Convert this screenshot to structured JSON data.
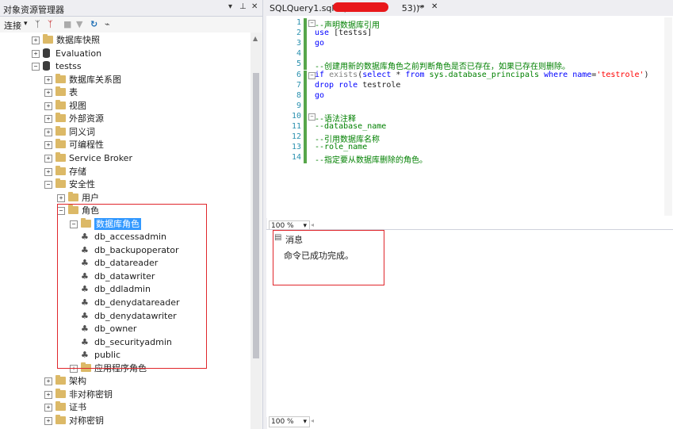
{
  "object_explorer": {
    "title": "对象资源管理器",
    "toolbar": {
      "connect_label": "连接",
      "dropdown_glyph": "▾"
    },
    "tree": [
      {
        "label": "数据库快照",
        "icon": "folder-icon",
        "expander": "+"
      },
      {
        "label": "Evaluation",
        "icon": "database-icon",
        "expander": "+"
      },
      {
        "label": "testss",
        "icon": "database-icon",
        "expander": "−"
      },
      {
        "label": "数据库关系图",
        "icon": "folder-icon",
        "expander": "+"
      },
      {
        "label": "表",
        "icon": "folder-icon",
        "expander": "+"
      },
      {
        "label": "视图",
        "icon": "folder-icon",
        "expander": "+"
      },
      {
        "label": "外部资源",
        "icon": "folder-icon",
        "expander": "+"
      },
      {
        "label": "同义词",
        "icon": "folder-icon",
        "expander": "+"
      },
      {
        "label": "可编程性",
        "icon": "folder-icon",
        "expander": "+"
      },
      {
        "label": "Service Broker",
        "icon": "folder-icon",
        "expander": "+"
      },
      {
        "label": "存储",
        "icon": "folder-icon",
        "expander": "+"
      },
      {
        "label": "安全性",
        "icon": "folder-icon",
        "expander": "−"
      },
      {
        "label": "用户",
        "icon": "folder-icon",
        "expander": "+"
      },
      {
        "label": "角色",
        "icon": "folder-icon",
        "expander": "−"
      },
      {
        "label": "数据库角色",
        "icon": "folder-icon",
        "expander": "−",
        "selected": true
      },
      {
        "label": "db_accessadmin",
        "icon": "role-icon",
        "expander": ""
      },
      {
        "label": "db_backupoperator",
        "icon": "role-icon",
        "expander": ""
      },
      {
        "label": "db_datareader",
        "icon": "role-icon",
        "expander": ""
      },
      {
        "label": "db_datawriter",
        "icon": "role-icon",
        "expander": ""
      },
      {
        "label": "db_ddladmin",
        "icon": "role-icon",
        "expander": ""
      },
      {
        "label": "db_denydatareader",
        "icon": "role-icon",
        "expander": ""
      },
      {
        "label": "db_denydatawriter",
        "icon": "role-icon",
        "expander": ""
      },
      {
        "label": "db_owner",
        "icon": "role-icon",
        "expander": ""
      },
      {
        "label": "db_securityadmin",
        "icon": "role-icon",
        "expander": ""
      },
      {
        "label": "public",
        "icon": "role-icon",
        "expander": ""
      },
      {
        "label": "应用程序角色",
        "icon": "folder-icon",
        "expander": "+"
      },
      {
        "label": "架构",
        "icon": "folder-icon",
        "expander": "+"
      },
      {
        "label": "非对称密钥",
        "icon": "folder-icon",
        "expander": "+"
      },
      {
        "label": "证书",
        "icon": "folder-icon",
        "expander": "+"
      },
      {
        "label": "对称密钥",
        "icon": "folder-icon",
        "expander": "+"
      }
    ]
  },
  "editor": {
    "tab_title_prefix": "SQLQuery1.sql - (",
    "tab_title_suffix": "53))*",
    "lines": [
      {
        "n": "1",
        "text": "--声明数据库引用"
      },
      {
        "n": "2",
        "text": "use [testss]"
      },
      {
        "n": "3",
        "text": "go"
      },
      {
        "n": "4",
        "text": ""
      },
      {
        "n": "5",
        "text": "--创建用新的数据库角色之前判断角色是否已存在，如果已存在则删除。"
      },
      {
        "n": "6",
        "text": "if exists(select * from sys.database_principals where name='testrole')"
      },
      {
        "n": "7",
        "text": "drop role testrole"
      },
      {
        "n": "8",
        "text": "go"
      },
      {
        "n": "9",
        "text": ""
      },
      {
        "n": "10",
        "text": "--语法注释"
      },
      {
        "n": "11",
        "text": "--database_name"
      },
      {
        "n": "12",
        "text": "--引用数据库名称"
      },
      {
        "n": "13",
        "text": "--role_name"
      },
      {
        "n": "14",
        "text": "--指定要从数据库删除的角色。"
      }
    ],
    "zoom": "100 %"
  },
  "results": {
    "tab_label": "消息",
    "message": "命令已成功完成。",
    "zoom": "100 %"
  },
  "colors": {
    "keyword": "#0000ff",
    "comment": "#008000",
    "string": "#ff0000",
    "selection": "#3399ff",
    "annotation": "#e0262b"
  }
}
